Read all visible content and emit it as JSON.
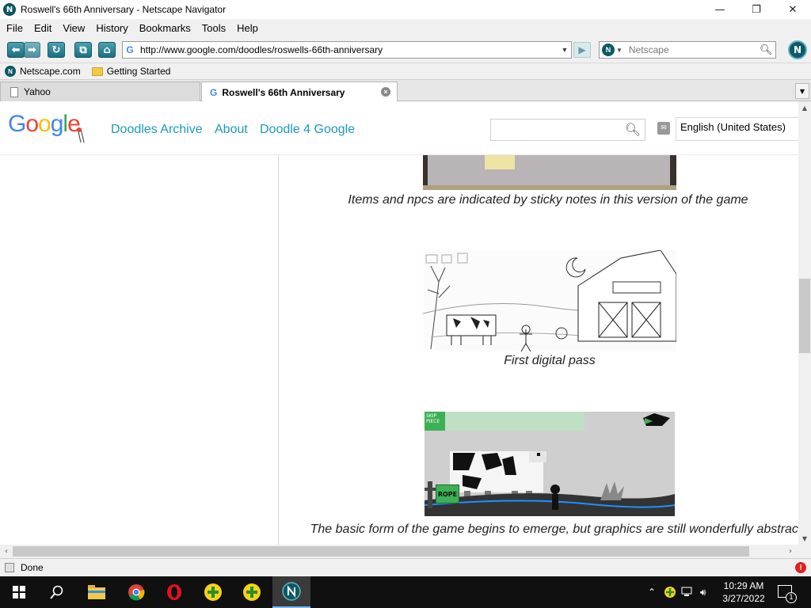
{
  "window": {
    "title": "Roswell's 66th Anniversary - Netscape Navigator",
    "app_icon_letter": "N",
    "min_glyph": "—",
    "max_glyph": "❐",
    "close_glyph": "✕"
  },
  "menu": [
    "File",
    "Edit",
    "View",
    "History",
    "Bookmarks",
    "Tools",
    "Help"
  ],
  "toolbar": {
    "url": "http://www.google.com/doodles/roswells-66th-anniversary",
    "search_placeholder": "Netscape",
    "url_favicon": "G"
  },
  "bookmarks": [
    {
      "label": "Netscape.com",
      "icon": "netscape-icon"
    },
    {
      "label": "Getting Started",
      "icon": "folder-icon"
    }
  ],
  "tabs": [
    {
      "label": "Yahoo",
      "active": false
    },
    {
      "label": "Roswell's 66th Anniversary",
      "active": true
    }
  ],
  "page": {
    "logo_letters": [
      "G",
      "o",
      "o",
      "g",
      "l",
      "e"
    ],
    "nav_links": [
      "Doodles Archive",
      "About",
      "Doodle 4 Google"
    ],
    "language": "English (United States)",
    "captions": [
      "Items and npcs are indicated by sticky notes in this version of the game",
      "First digital pass",
      "The basic form of the game begins to emerge, but graphics are still wonderfully abstract"
    ],
    "game_items": {
      "rope_label": "ROPE",
      "skip_label": "SKIP PIECE"
    }
  },
  "status": {
    "text": "Done"
  },
  "taskbar": {
    "time": "10:29 AM",
    "date": "3/27/2022",
    "notification_count": "1"
  },
  "colors": {
    "link": "#1a9ac0",
    "netscape_teal": "#0b5a66",
    "taskbar": "#101010"
  }
}
